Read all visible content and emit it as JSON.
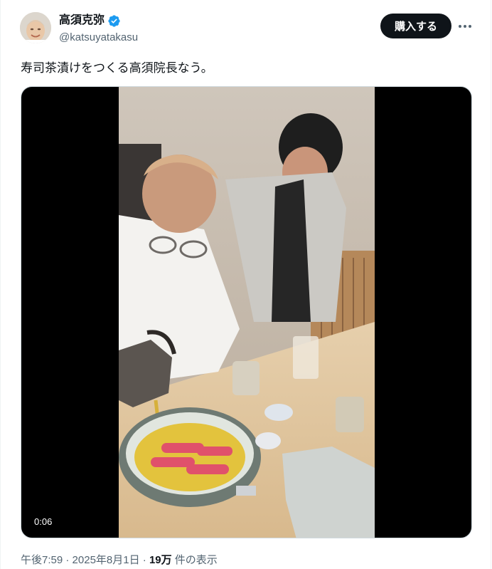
{
  "author": {
    "display_name": "高須克弥",
    "handle": "@katsuyatakasu",
    "verified": true
  },
  "actions": {
    "subscribe_label": "購入する",
    "more_icon": "more-horizontal-icon"
  },
  "tweet": {
    "text": "寿司茶漬けをつくる高須院長なう。"
  },
  "media": {
    "type": "video",
    "duration": "0:06"
  },
  "meta": {
    "time": "午後7:59",
    "separator1": " · ",
    "date": "2025年8月1日",
    "separator2": " · ",
    "views_count": "19万",
    "views_label": " 件の表示"
  },
  "colors": {
    "text_primary": "#0f1419",
    "text_secondary": "#536471",
    "verified_blue": "#1d9bf0",
    "button_bg": "#0f1419",
    "button_fg": "#ffffff",
    "media_letterbox": "#000000"
  }
}
